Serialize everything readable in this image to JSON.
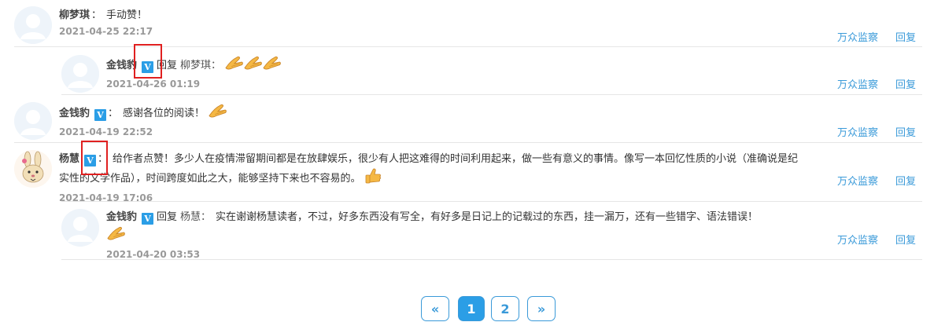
{
  "comments": [
    {
      "author": "柳梦琪",
      "colon": "：",
      "content": "手动赞！",
      "date": "2021-04-25 22:17",
      "actions": [
        "万众监察",
        "回复"
      ]
    },
    {
      "author": "金钱豹",
      "badge": "V",
      "reply_word": "回复",
      "reply_to": "柳梦琪：",
      "content": "",
      "date": "2021-04-26 01:19",
      "actions": [
        "万众监察",
        "回复"
      ]
    },
    {
      "author": "金钱豹",
      "badge": "V",
      "colon": "：",
      "content": "感谢各位的阅读！",
      "date": "2021-04-19 22:52",
      "actions": [
        "万众监察",
        "回复"
      ]
    },
    {
      "author": "杨慧",
      "badge": "V",
      "colon": "：",
      "content": "给作者点赞！多少人在疫情滞留期间都是在放肆娱乐，很少有人把这难得的时间利用起来，做一些有意义的事情。像写一本回忆性质的小说（准确说是纪实性的文学作品），时间跨度如此之大，能够坚持下来也不容易的。",
      "date": "2021-04-19 17:06",
      "actions": [
        "万众监察",
        "回复"
      ]
    },
    {
      "author": "金钱豹",
      "badge": "V",
      "reply_word": "回复",
      "reply_to": "杨慧：",
      "content": "实在谢谢杨慧读者，不过，好多东西没有写全，有好多是日记上的记载过的东西，挂一漏万，还有一些错字、语法错误！",
      "date": "2021-04-20 03:53",
      "actions": [
        "万众监察",
        "回复"
      ]
    }
  ],
  "pagination": {
    "prev": "«",
    "pages": [
      "1",
      "2"
    ],
    "current": "1",
    "next": "»"
  },
  "colors": {
    "accent": "#2b9ee6",
    "link": "#3a9ad9",
    "highlight_box": "#e02020"
  }
}
